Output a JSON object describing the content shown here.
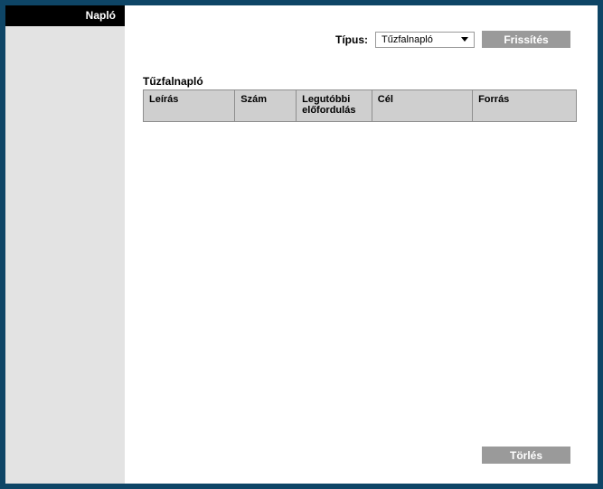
{
  "sidebar": {
    "title": "Napló"
  },
  "topbar": {
    "type_label": "Típus:",
    "type_selected": "Tűzfalnapló",
    "refresh_label": "Frissítés"
  },
  "log": {
    "title": "Tűzfalnapló",
    "columns": {
      "description": "Leírás",
      "count": "Szám",
      "last_occurrence": "Legutóbbi előfordulás",
      "destination": "Cél",
      "source": "Forrás"
    },
    "rows": []
  },
  "actions": {
    "delete_label": "Törlés"
  }
}
